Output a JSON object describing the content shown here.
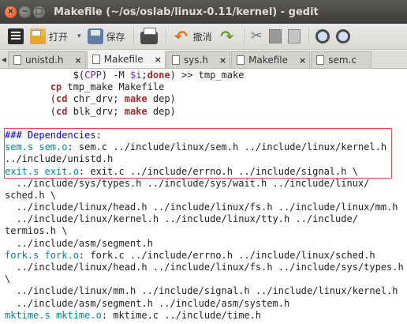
{
  "window": {
    "title": "Makefile (~/os/oslab/linux-0.11/kernel) - gedit",
    "controls": {
      "close": "×",
      "minimize": "−",
      "maximize": "□"
    }
  },
  "toolbar": {
    "open_label": "打开",
    "save_label": "保存",
    "undo_label": "撤消",
    "icons": [
      "new-document-icon",
      "open-icon",
      "save-icon",
      "print-icon",
      "undo-icon",
      "redo-icon",
      "cut-icon",
      "copy-icon",
      "paste-icon",
      "search-icon",
      "replace-icon"
    ]
  },
  "tabs": [
    {
      "label": "unistd.h",
      "active": false
    },
    {
      "label": "Makefile",
      "active": true
    },
    {
      "label": "sys.h",
      "active": false
    },
    {
      "label": "Makefile",
      "active": false
    },
    {
      "label": "sem.c",
      "active": false
    }
  ],
  "editor": {
    "lines": [
      "            $(CPP) -M $$i;done) >> tmp_make",
      "        cp tmp_make Makefile",
      "        (cd chr_drv; make dep)",
      "        (cd blk_drv; make dep)",
      "",
      "### Dependencies:",
      "sem.s sem.o: sem.c ../include/linux/sem.h ../include/linux/kernel.h",
      "../include/unistd.h",
      "exit.s exit.o: exit.c ../include/errno.h ../include/signal.h \\",
      "  ../include/sys/types.h ../include/sys/wait.h ../include/linux/",
      "sched.h \\",
      "  ../include/linux/head.h ../include/linux/fs.h ../include/linux/mm.h",
      "  ../include/linux/kernel.h ../include/linux/tty.h ../include/",
      "termios.h \\",
      "  ../include/asm/segment.h",
      "fork.s fork.o: fork.c ../include/errno.h ../include/linux/sched.h",
      "  ../include/linux/head.h ../include/linux/fs.h ../include/sys/types.h",
      "\\",
      "  ../include/linux/mm.h ../include/signal.h ../include/linux/kernel.h",
      "  ../include/asm/segment.h ../include/asm/system.h",
      "mktime.s mktime.o: mktime.c ../include/time.h"
    ]
  },
  "colors": {
    "keyword": "#a52a2a",
    "target": "#008a8c",
    "comment": "#0000ff",
    "highlight_box": "#d9534f"
  }
}
